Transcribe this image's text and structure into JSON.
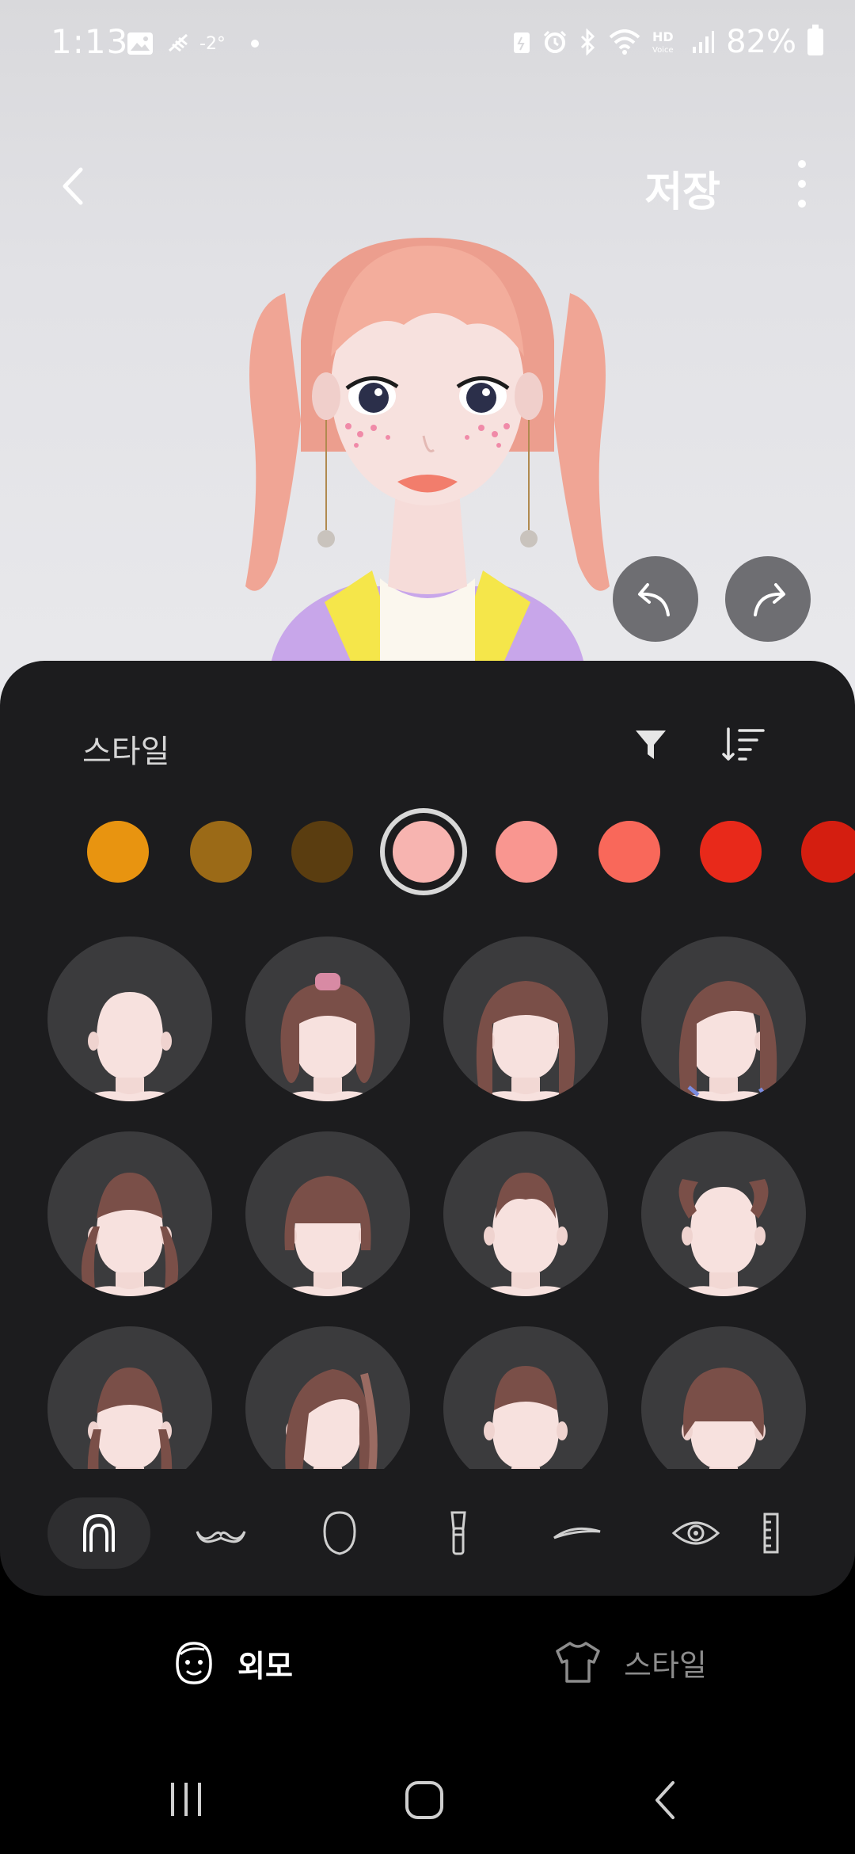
{
  "status_bar": {
    "time": "1:13",
    "temperature": "-2°",
    "battery": "82%",
    "hd_voice": "HD"
  },
  "header": {
    "save_label": "저장"
  },
  "panel": {
    "title": "스타일",
    "swatches": [
      "#e89410",
      "#9b6a17",
      "#5a3d10",
      "#f7b4b0",
      "#f99690",
      "#f9685a",
      "#e8291a",
      "#d41e10"
    ],
    "selected_swatch_index": 3
  },
  "category_icons": [
    "hair-icon",
    "mustache-icon",
    "face-shape-icon",
    "makeup-brush-icon",
    "eyebrow-icon",
    "eye-icon",
    "ruler-icon"
  ],
  "bottom_nav": {
    "tabs": [
      {
        "label": "외모",
        "icon": "face-icon",
        "active": true
      },
      {
        "label": "스타일",
        "icon": "shirt-icon",
        "active": false
      }
    ]
  },
  "colors": {
    "accent_hair": "#f2a79a",
    "panel_bg": "#1c1c1e",
    "item_bg": "#3b3b3d"
  }
}
